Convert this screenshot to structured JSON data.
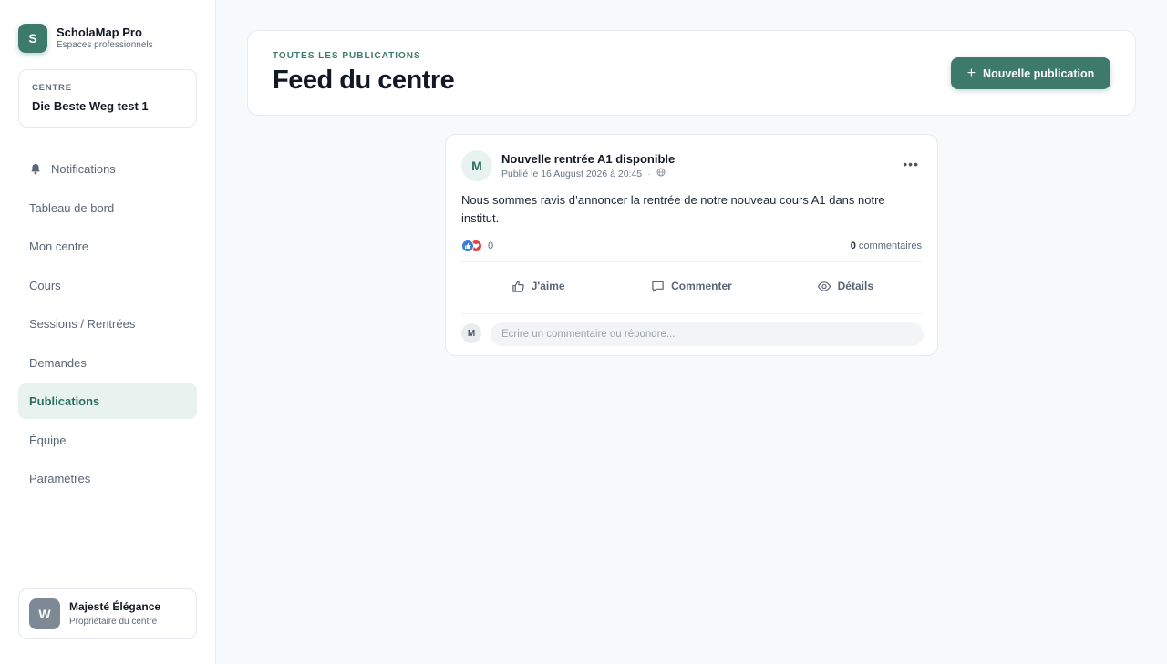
{
  "brand": {
    "logo_letter": "S",
    "name": "ScholaMap Pro",
    "subtitle": "Espaces professionnels"
  },
  "centre": {
    "label": "CENTRE",
    "name": "Die Beste Weg test 1"
  },
  "nav": {
    "items": [
      {
        "label": "Notifications",
        "icon": "bell-icon"
      },
      {
        "label": "Tableau de bord"
      },
      {
        "label": "Mon centre"
      },
      {
        "label": "Cours"
      },
      {
        "label": "Sessions / Rentrées"
      },
      {
        "label": "Demandes"
      },
      {
        "label": "Publications",
        "active": true
      },
      {
        "label": "Équipe"
      },
      {
        "label": "Paramètres"
      }
    ]
  },
  "user": {
    "avatar_letter": "W",
    "name": "Majesté Élégance",
    "role": "Propriétaire du centre"
  },
  "header": {
    "eyebrow": "TOUTES LES PUBLICATIONS",
    "title": "Feed du centre",
    "new_button": "Nouvelle publication"
  },
  "post": {
    "avatar_letter": "M",
    "title": "Nouvelle rentrée A1 disponible",
    "meta": "Publié le 16 August 2026 à 20:45",
    "body": "Nous sommes ravis d’annoncer la rentrée de notre nouveau cours A1 dans notre institut.",
    "reaction_count": "0",
    "comments_count": "0",
    "comments_label": "commentaires",
    "actions": {
      "like": "J'aime",
      "comment": "Commenter",
      "details": "Détails"
    },
    "comment_avatar_letter": "M",
    "comment_placeholder": "Écrire un commentaire ou répondre..."
  },
  "colors": {
    "accent": "#3d7a6c",
    "active_bg": "#e8f3ef",
    "background": "#f8f9fb"
  }
}
